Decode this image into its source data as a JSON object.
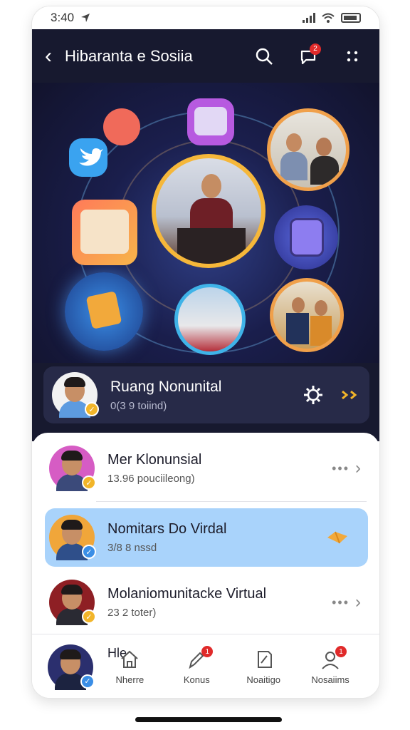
{
  "status_bar": {
    "time": "3:40"
  },
  "header": {
    "title": "Hibaranta e Sosiia",
    "notification_count": "2",
    "icons": [
      "back-arrow-icon",
      "search-icon",
      "chat-icon",
      "more-dots-icon"
    ]
  },
  "featured": {
    "title": "Ruang Nonunital",
    "subtitle": "0(3 9 toiind)",
    "icons": [
      "settings-icon",
      "forward-arrows-icon"
    ]
  },
  "list": [
    {
      "name": "Mer Klonunsial",
      "meta": "13.96 pouciileong)",
      "action": "more",
      "selected": false
    },
    {
      "name": "Nomitars Do Virdal",
      "meta": "3/8 8 nssd",
      "action": "ticket",
      "selected": true
    },
    {
      "name": "Molaniomunitacke Virtual",
      "meta": "23 2 toter)",
      "action": "more",
      "selected": false
    }
  ],
  "partial_row": {
    "name": "Hle"
  },
  "tabbar": {
    "tabs": [
      {
        "label": "Nherre",
        "icon": "home-icon",
        "badge": ""
      },
      {
        "label": "Konus",
        "icon": "pen-icon",
        "badge": "1"
      },
      {
        "label": "Noaitigo",
        "icon": "edit-icon",
        "badge": ""
      },
      {
        "label": "Nosaiims",
        "icon": "profile-icon",
        "badge": "1"
      }
    ]
  },
  "colors": {
    "header_bg": "#17192f",
    "selected_row": "#a9d3fb",
    "badge": "#e02a2a",
    "verify": "#f2b529"
  }
}
